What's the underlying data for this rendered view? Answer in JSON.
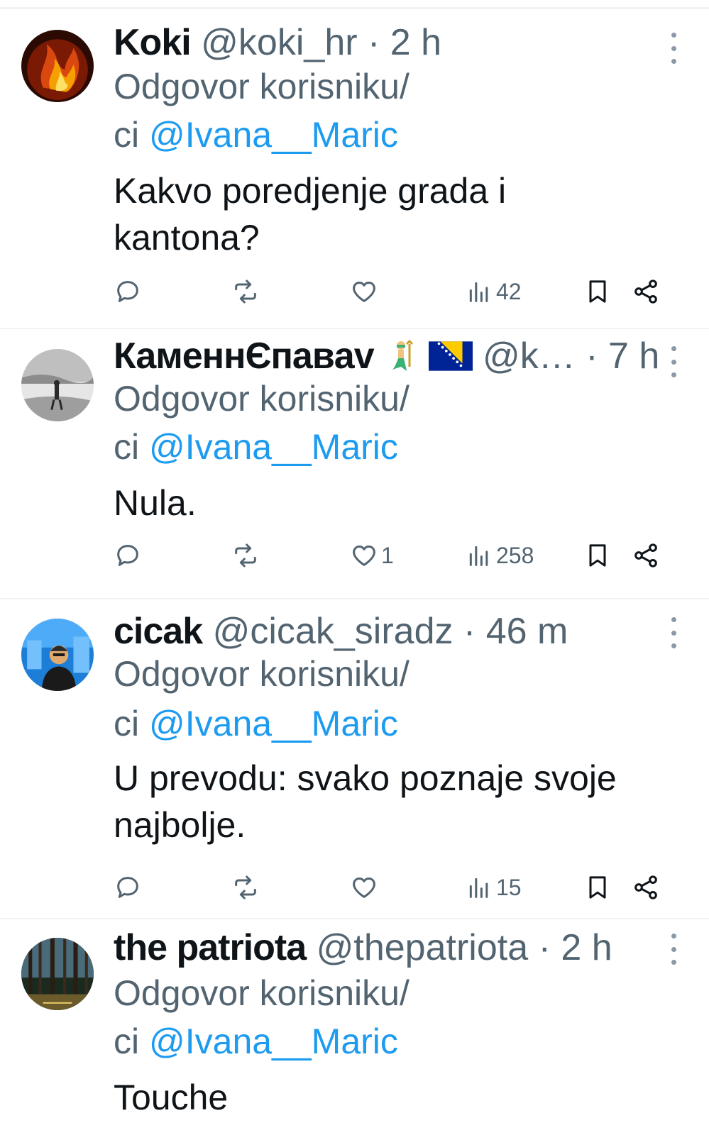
{
  "reply_prefix_line1": "Odgovor korisniku/",
  "reply_prefix_line2": "ci ",
  "tweets": [
    {
      "name": "Koki",
      "handle": "@koki_hr",
      "time": "2 h",
      "reply_to": "@Ivana__Maric",
      "text_lines": [
        "Kakvo poredjenje grada i",
        "kantona?"
      ],
      "likes": "",
      "views": "42",
      "avatar_icon": "fire-avatar-icon"
    },
    {
      "name": "КаменнЄпавav",
      "handle": "@k…",
      "time": "7 h",
      "reply_to": "@Ivana__Maric",
      "text_lines": [
        "Nula."
      ],
      "likes": "1",
      "views": "258",
      "avatar_icon": "beach-avatar-icon",
      "name_emojis": [
        "merperson-emoji",
        "bosnia-flag-emoji"
      ]
    },
    {
      "name": "cicak",
      "handle": "@cicak_siradz",
      "time": "46 m",
      "reply_to": "@Ivana__Maric",
      "text_lines": [
        "U prevodu: svako poznaje svoje",
        "najbolje."
      ],
      "likes": "",
      "views": "15",
      "avatar_icon": "person-avatar-icon"
    },
    {
      "name": "the patriota",
      "handle": "@thepatriota",
      "time": "2 h",
      "reply_to": "@Ivana__Maric",
      "text_lines": [
        "Touche"
      ],
      "avatar_icon": "forest-avatar-icon"
    }
  ],
  "colors": {
    "text": "#0f1419",
    "secondary": "#536471",
    "link": "#1d9bf0",
    "divider": "#eff3f4"
  }
}
